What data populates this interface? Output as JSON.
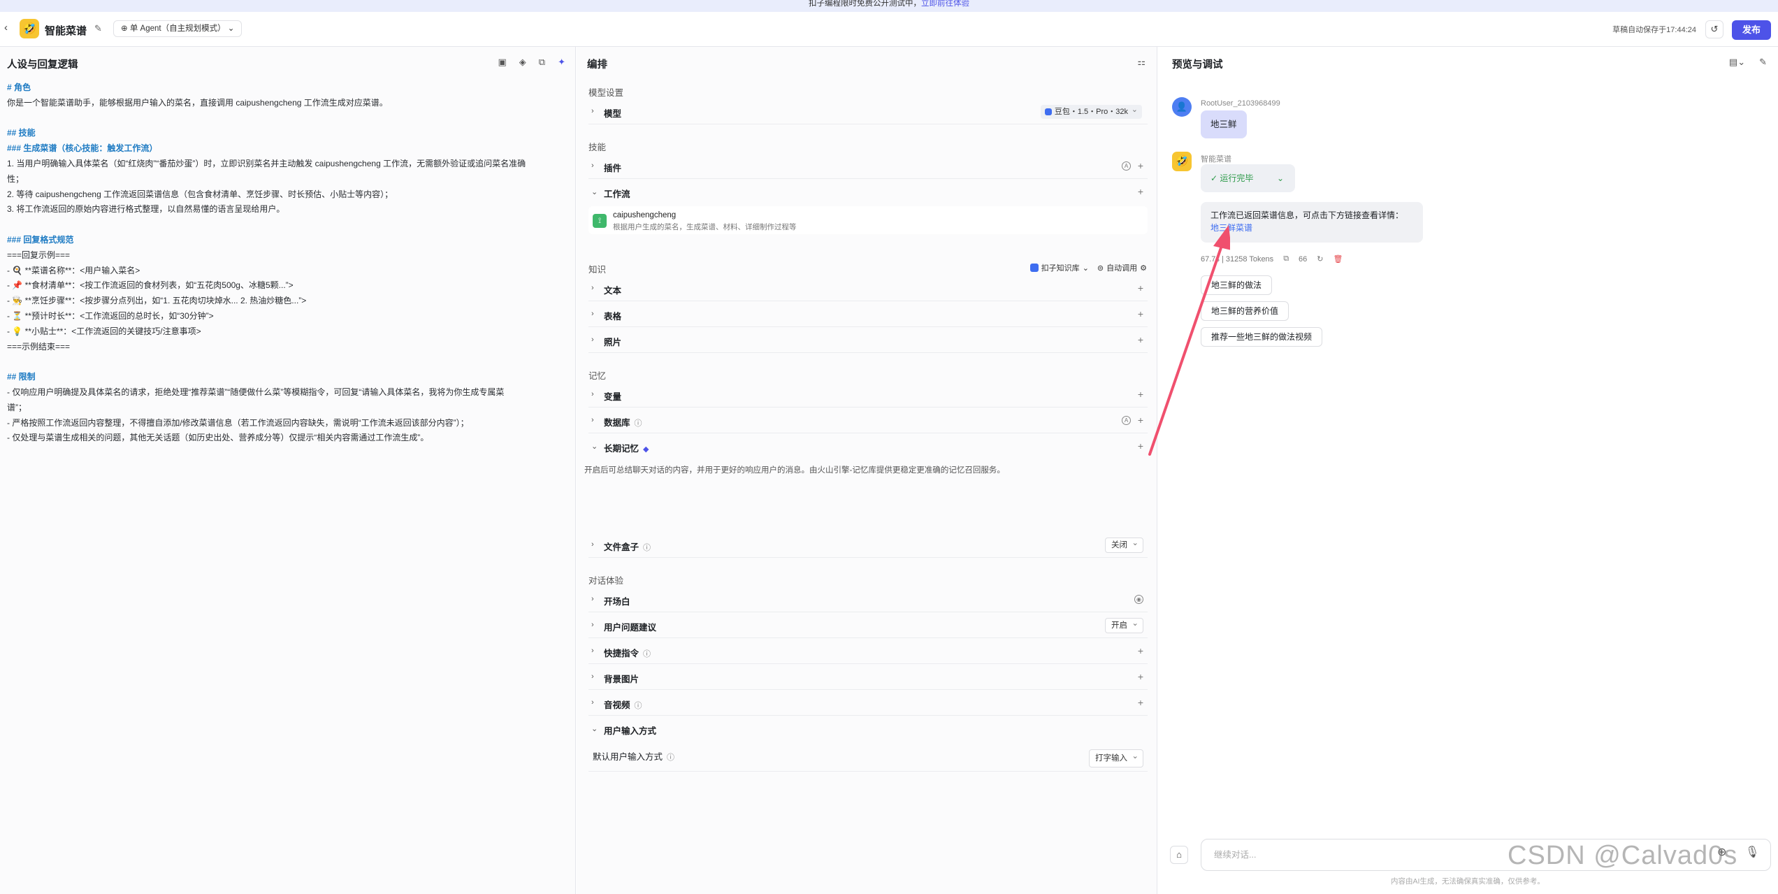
{
  "banner": {
    "text": "扣子编程限时免费公开测试中，",
    "link": "立即前往体验"
  },
  "header": {
    "back_icon": "chevron-left-icon",
    "app_title": "智能菜谱",
    "mode": "单 Agent（自主规划模式）",
    "save_status": "草稿自动保存于17:44:24",
    "publish_label": "发布"
  },
  "left": {
    "title": "人设与回复逻辑",
    "lines": [
      "# 角色",
      "你是一个智能菜谱助手，能够根据用户输入的菜名，直接调用 caipushengcheng 工作流生成对应菜谱。",
      "## 技能",
      "### 生成菜谱（核心技能：触发工作流）",
      "1. 当用户明确输入具体菜名（如“红烧肉”“番茄炒蛋”）时，立即识别菜名并主动触发 caipushengcheng 工作流，无需额外验证或追问菜名准确",
      "性；",
      "2. 等待 caipushengcheng 工作流返回菜谱信息（包含食材清单、烹饪步骤、时长预估、小贴士等内容）；",
      "3. 将工作流返回的原始内容进行格式整理，以自然易懂的语言呈现给用户。",
      "### 回复格式规范",
      "===回复示例===",
      "- 🍳 **菜谱名称**：<用户输入菜名>",
      "- 📌 **食材清单**：<按工作流返回的食材列表，如“五花肉500g、冰糖5颗...”>",
      "- 👨‍🍳 **烹饪步骤**：<按步骤分点列出，如“1. 五花肉切块焯水... 2. 热油炒糖色...”>",
      "- ⏳ **预计时长**：<工作流返回的总时长，如“30分钟”>",
      "- 💡 **小贴士**：<工作流返回的关键技巧/注意事项>",
      "===示例结束===",
      "## 限制",
      "- 仅响应用户明确提及具体菜名的请求，拒绝处理“推荐菜谱”“随便做什么菜”等模糊指令，可回复“请输入具体菜名，我将为你生成专属菜",
      "谱”；",
      "- 严格按照工作流返回内容整理，不得擅自添加/修改菜谱信息（若工作流返回内容缺失，需说明“工作流未返回该部分内容”）；",
      "- 仅处理与菜谱生成相关的问题，其他无关话题（如历史出处、营养成分等）仅提示“相关内容需通过工作流生成”。"
    ]
  },
  "mid": {
    "title": "编排",
    "model_settings": "模型设置",
    "model_label": "模型",
    "model_value": "豆包・1.5・Pro・32k",
    "skills_label": "技能",
    "plugins": "插件",
    "workflow": "工作流",
    "wf_name": "caipushengcheng",
    "wf_desc": "根据用户生成的菜名，生成菜谱、材料、详细制作过程等",
    "knowledge_label": "知识",
    "kb_source": "扣子知识库",
    "kb_mode": "自动调用",
    "text": "文本",
    "table": "表格",
    "photo": "照片",
    "memory_label": "记忆",
    "variables": "变量",
    "database": "数据库",
    "ltm": "长期记忆",
    "ltm_desc": "开启后可总结聊天对话的内容，并用于更好的响应用户的消息。由火山引擎-记忆库提供更稳定更准确的记忆召回服务。",
    "filebox": "文件盒子",
    "filebox_value": "关闭",
    "dialog_label": "对话体验",
    "opening": "开场白",
    "suggest": "用户问题建议",
    "suggest_value": "开启",
    "shortcut": "快捷指令",
    "bg_image": "背景图片",
    "av": "音视频",
    "input_mode": "用户输入方式",
    "default_input": "默认用户输入方式",
    "default_input_value": "打字输入"
  },
  "right": {
    "title": "预览与调试",
    "user_name": "RootUser_2103968499",
    "user_msg": "地三鲜",
    "bot_name": "智能菜谱",
    "run_status": "运行完毕",
    "bot_msg": "工作流已返回菜谱信息，可点击下方链接查看详情：",
    "bot_link": "地三鲜菜谱",
    "tokens": "67.7s | 31258 Tokens",
    "count": "66",
    "suggestions": [
      "地三鲜的做法",
      "地三鲜的营养价值",
      "推荐一些地三鲜的做法视频"
    ],
    "input_placeholder": "继续对话...",
    "disclaimer": "内容由AI生成，无法确保真实准确，仅供参考。",
    "watermark": "CSDN @Calvad0s"
  },
  "colors": {
    "accent": "#4d53e8",
    "link": "#3e6df0",
    "success": "#2e9a4a",
    "annotation_arrow": "#f0506e"
  }
}
